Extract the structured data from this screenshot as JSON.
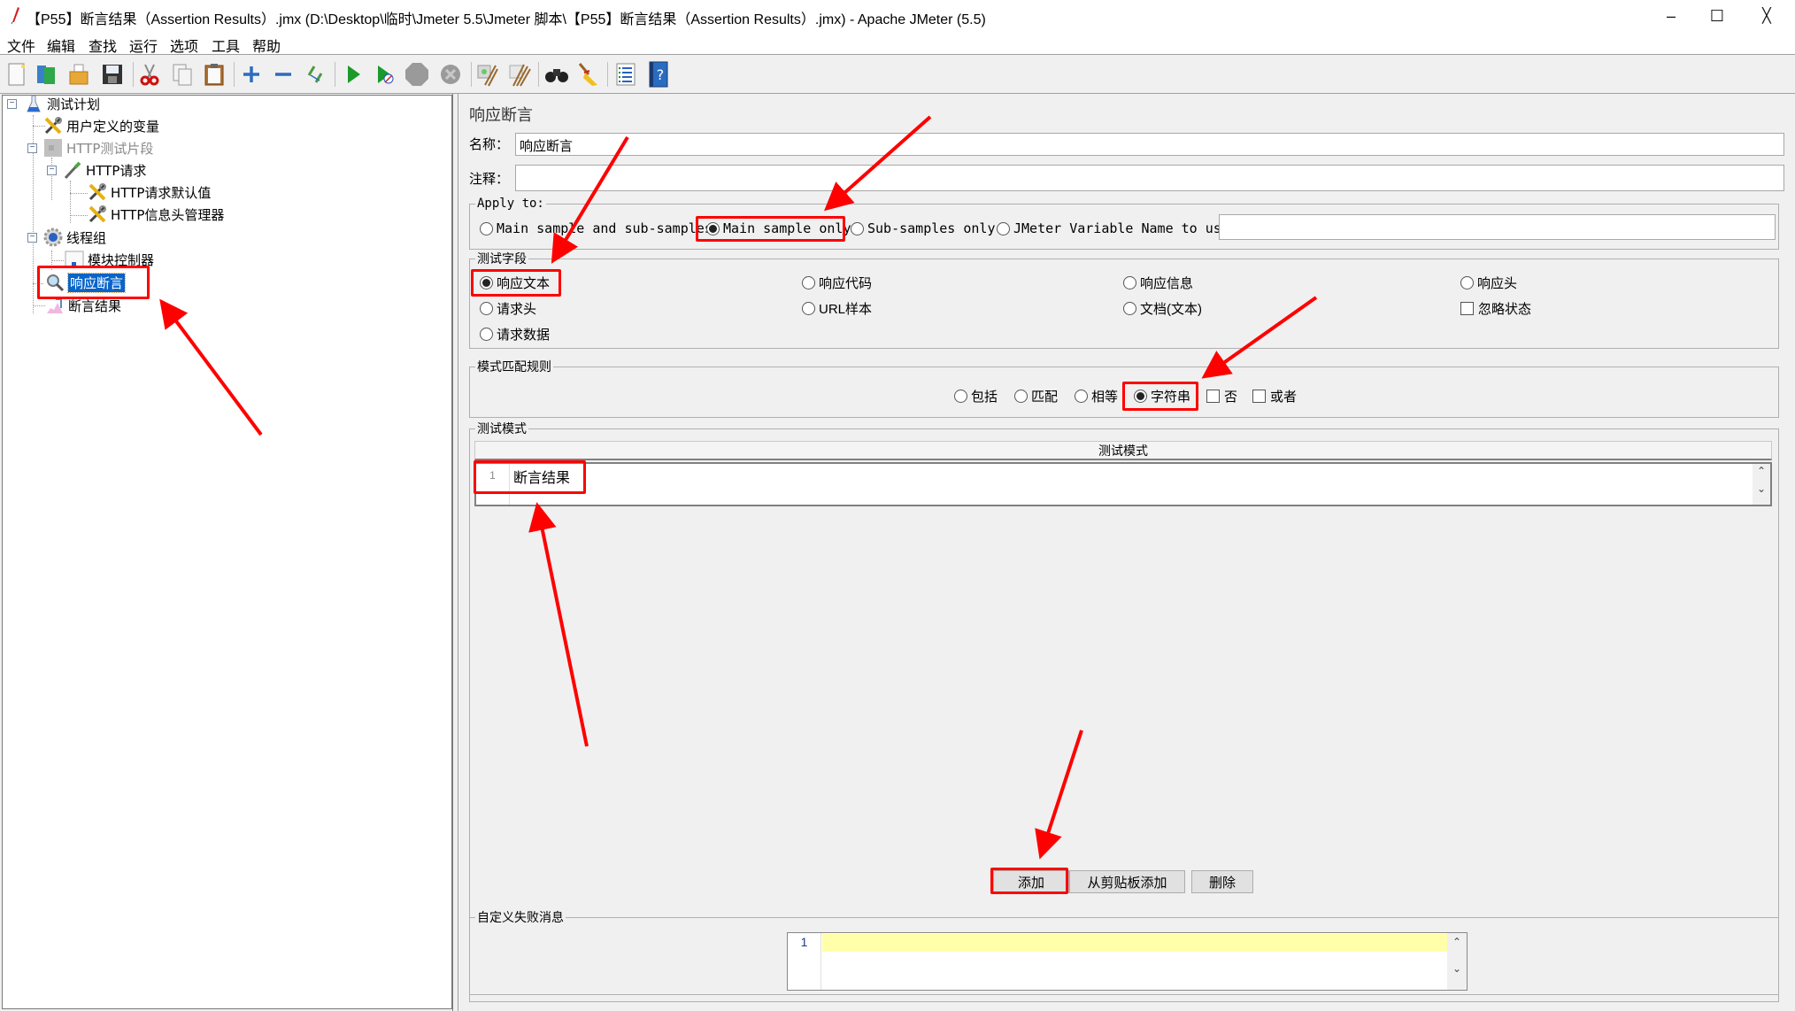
{
  "window": {
    "title": "【P55】断言结果（Assertion Results）.jmx (D:\\Desktop\\临时\\Jmeter 5.5\\Jmeter 脚本\\【P55】断言结果（Assertion Results）.jmx) - Apache JMeter (5.5)",
    "minimize": "–",
    "maximize": "☐",
    "close": "╳"
  },
  "menu": [
    "文件",
    "编辑",
    "查找",
    "运行",
    "选项",
    "工具",
    "帮助"
  ],
  "toolbar": [
    {
      "name": "new-icon",
      "glyph": "📄"
    },
    {
      "name": "templates-icon",
      "glyph": "📚"
    },
    {
      "name": "open-icon",
      "glyph": "📂"
    },
    {
      "name": "save-icon",
      "glyph": "💾"
    },
    {
      "name": "cut-icon",
      "glyph": "✂"
    },
    {
      "name": "copy-icon",
      "glyph": "⎘"
    },
    {
      "name": "paste-icon",
      "glyph": "📋"
    },
    {
      "name": "expand-icon",
      "glyph": "+"
    },
    {
      "name": "collapse-icon",
      "glyph": "−"
    },
    {
      "name": "toggle-icon",
      "glyph": "⤡"
    },
    {
      "name": "start-icon",
      "glyph": "▶"
    },
    {
      "name": "start-no-pause-icon",
      "glyph": "▶"
    },
    {
      "name": "stop-icon",
      "glyph": "⬣"
    },
    {
      "name": "shutdown-icon",
      "glyph": "✖"
    },
    {
      "name": "clear-icon",
      "glyph": "🧹"
    },
    {
      "name": "clear-all-icon",
      "glyph": "🧹"
    },
    {
      "name": "search-icon",
      "glyph": "🔭"
    },
    {
      "name": "reset-search-icon",
      "glyph": "🧹"
    },
    {
      "name": "function-helper-icon",
      "glyph": "☰"
    },
    {
      "name": "help-icon",
      "glyph": "?"
    }
  ],
  "tree": [
    {
      "label": "测试计划",
      "icon": "test-plan-icon",
      "glyph": "⚗",
      "disabled": false
    },
    {
      "label": "用户定义的变量",
      "icon": "config-icon",
      "glyph": "🔧",
      "disabled": false
    },
    {
      "label": "HTTP测试片段",
      "icon": "fragment-icon",
      "glyph": "▦",
      "disabled": true
    },
    {
      "label": "HTTP请求",
      "icon": "sampler-icon",
      "glyph": "💉",
      "disabled": false
    },
    {
      "label": "HTTP请求默认值",
      "icon": "config-icon",
      "glyph": "🔧",
      "disabled": false
    },
    {
      "label": "HTTP信息头管理器",
      "icon": "config-icon",
      "glyph": "🔧",
      "disabled": false
    },
    {
      "label": "线程组",
      "icon": "thread-group-icon",
      "glyph": "⚙",
      "disabled": false
    },
    {
      "label": "模块控制器",
      "icon": "controller-icon",
      "glyph": "▭",
      "disabled": false
    },
    {
      "label": "响应断言",
      "icon": "assertion-icon",
      "glyph": "🔍",
      "disabled": false,
      "selected": true
    },
    {
      "label": "断言结果",
      "icon": "listener-icon",
      "glyph": "📈",
      "disabled": false
    }
  ],
  "panel": {
    "heading": "响应断言",
    "name_label": "名称：",
    "name_value": "响应断言",
    "comment_label": "注释：",
    "comment_value": "",
    "apply_to": {
      "legend": "Apply to:",
      "options": [
        "Main sample and sub-samples",
        "Main sample only",
        "Sub-samples only",
        "JMeter Variable Name to use"
      ],
      "selected": "Main sample only",
      "variable_value": ""
    },
    "test_field": {
      "legend": "测试字段",
      "options": [
        "响应文本",
        "响应代码",
        "响应信息",
        "响应头",
        "请求头",
        "URL样本",
        "文档(文本)",
        "忽略状态",
        "请求数据"
      ],
      "selected": "响应文本",
      "ignore_status_checked": false
    },
    "pattern_rules": {
      "legend": "模式匹配规则",
      "options": [
        "包括",
        "匹配",
        "相等",
        "字符串"
      ],
      "selected": "字符串",
      "not_label": "否",
      "not_checked": false,
      "or_label": "或者",
      "or_checked": false
    },
    "test_patterns": {
      "legend": "测试模式",
      "column_header": "测试模式",
      "rows": [
        {
          "line": "1",
          "value": "断言结果"
        }
      ],
      "buttons": {
        "add": "添加",
        "add_clipboard": "从剪贴板添加",
        "delete": "删除"
      }
    },
    "custom_message": {
      "legend": "自定义失败消息",
      "line": "1",
      "value": ""
    }
  },
  "annotation_color": "#ff0000",
  "scroll_up": "⌃",
  "scroll_down": "⌄"
}
